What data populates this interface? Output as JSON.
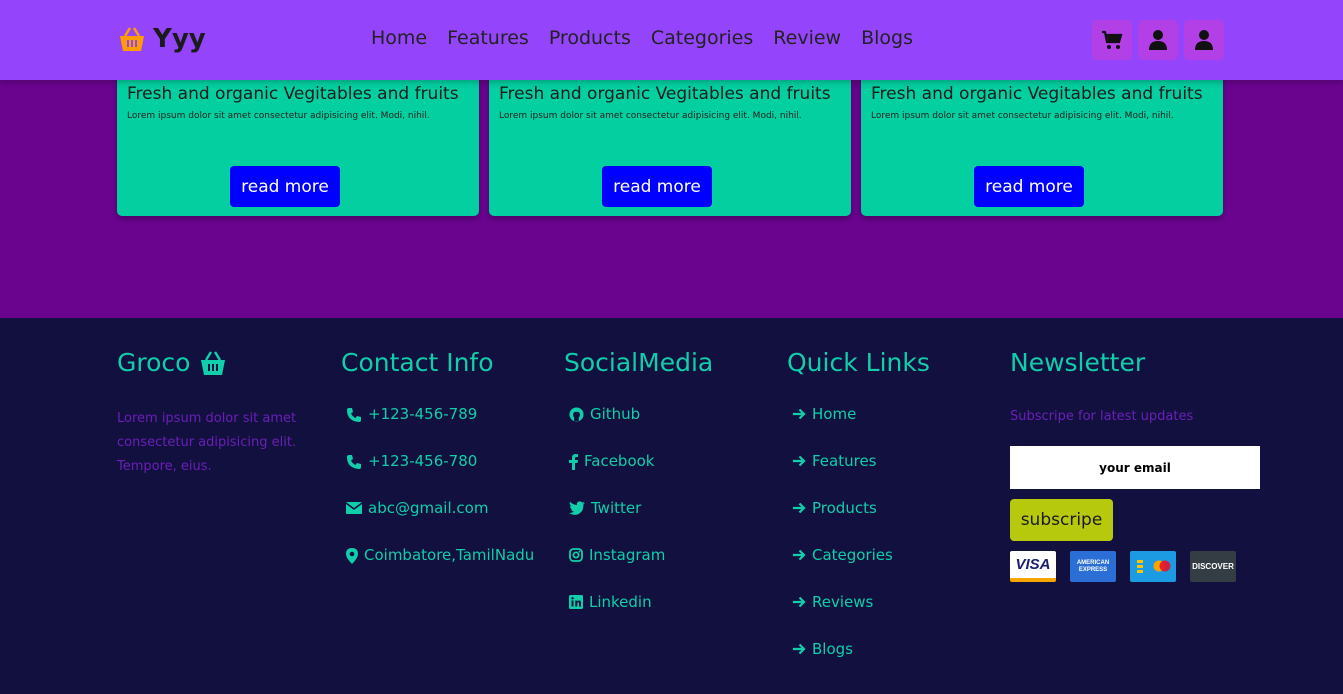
{
  "header": {
    "brand": "Yyy",
    "nav": [
      "Home",
      "Features",
      "Products",
      "Categories",
      "Review",
      "Blogs"
    ]
  },
  "cards": [
    {
      "title": "Fresh and organic Vegitables and fruits",
      "text": "Lorem ipsum dolor sit amet consectetur adipisicing elit. Modi, nihil.",
      "button": "read more"
    },
    {
      "title": "Fresh and organic Vegitables and fruits",
      "text": "Lorem ipsum dolor sit amet consectetur adipisicing elit. Modi, nihil.",
      "button": "read more"
    },
    {
      "title": "Fresh and organic Vegitables and fruits",
      "text": "Lorem ipsum dolor sit amet consectetur adipisicing elit. Modi, nihil.",
      "button": "read more"
    }
  ],
  "footer": {
    "about": {
      "title": "Groco",
      "text": "Lorem ipsum dolor sit amet consectetur adipisicing elit. Tempore, eius."
    },
    "contact": {
      "title": "Contact Info",
      "items": [
        "+123-456-789",
        "+123-456-780",
        "abc@gmail.com",
        "Coimbatore,TamilNadu"
      ]
    },
    "social": {
      "title": "SocialMedia",
      "items": [
        "Github",
        "Facebook",
        "Twitter",
        "Instagram",
        "Linkedin"
      ]
    },
    "quick": {
      "title": "Quick Links",
      "items": [
        "Home",
        "Features",
        "Products",
        "Categories",
        "Reviews",
        "Blogs"
      ]
    },
    "newsletter": {
      "title": "Newsletter",
      "text": "Subscripe for latest updates",
      "placeholder": "your email",
      "button": "subscripe"
    },
    "payment_cards": [
      "VISA",
      "AMERICAN EXPRESS",
      "MASTERCARD",
      "DISCOVER"
    ]
  },
  "colors": {
    "header": "#9444fb",
    "accent": "#10ceaa",
    "card": "#03cfa0",
    "footer": "#12103f",
    "button": "#0000ff"
  }
}
